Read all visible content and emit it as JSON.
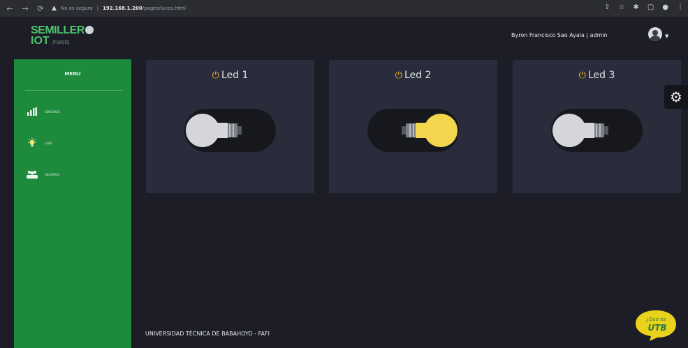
{
  "browser": {
    "security_text": "No es seguro",
    "url_host": "192.168.1.200",
    "url_path": "/pages/luces.html"
  },
  "header": {
    "logo_line1": "SEMILLER",
    "logo_line2": "IOT",
    "logo_tagline": "meets",
    "user_label": "Byron Francisco Sao Ayala | admin"
  },
  "sidebar": {
    "title": "MENU",
    "items": [
      {
        "label": "SENSORES",
        "icon": "bar-chart-icon"
      },
      {
        "label": "LEDS",
        "icon": "lightbulb-icon"
      },
      {
        "label": "USUARIOS",
        "icon": "users-icon"
      }
    ]
  },
  "leds": [
    {
      "label": "Led 1",
      "state": "off"
    },
    {
      "label": "Led 2",
      "state": "on"
    },
    {
      "label": "Led 3",
      "state": "off"
    }
  ],
  "footer": {
    "text": "UNIVERSIDAD TÉCNICA DE BABAHOYO - FAFI"
  },
  "badge": {
    "top": "¿Que es",
    "bottom": "UTB"
  },
  "colors": {
    "sidebar": "#1d8a3c",
    "card": "#2a2c3b",
    "bulb_on": "#f4d54e",
    "bulb_off": "#d5d6da",
    "power": "#f2c12e"
  }
}
